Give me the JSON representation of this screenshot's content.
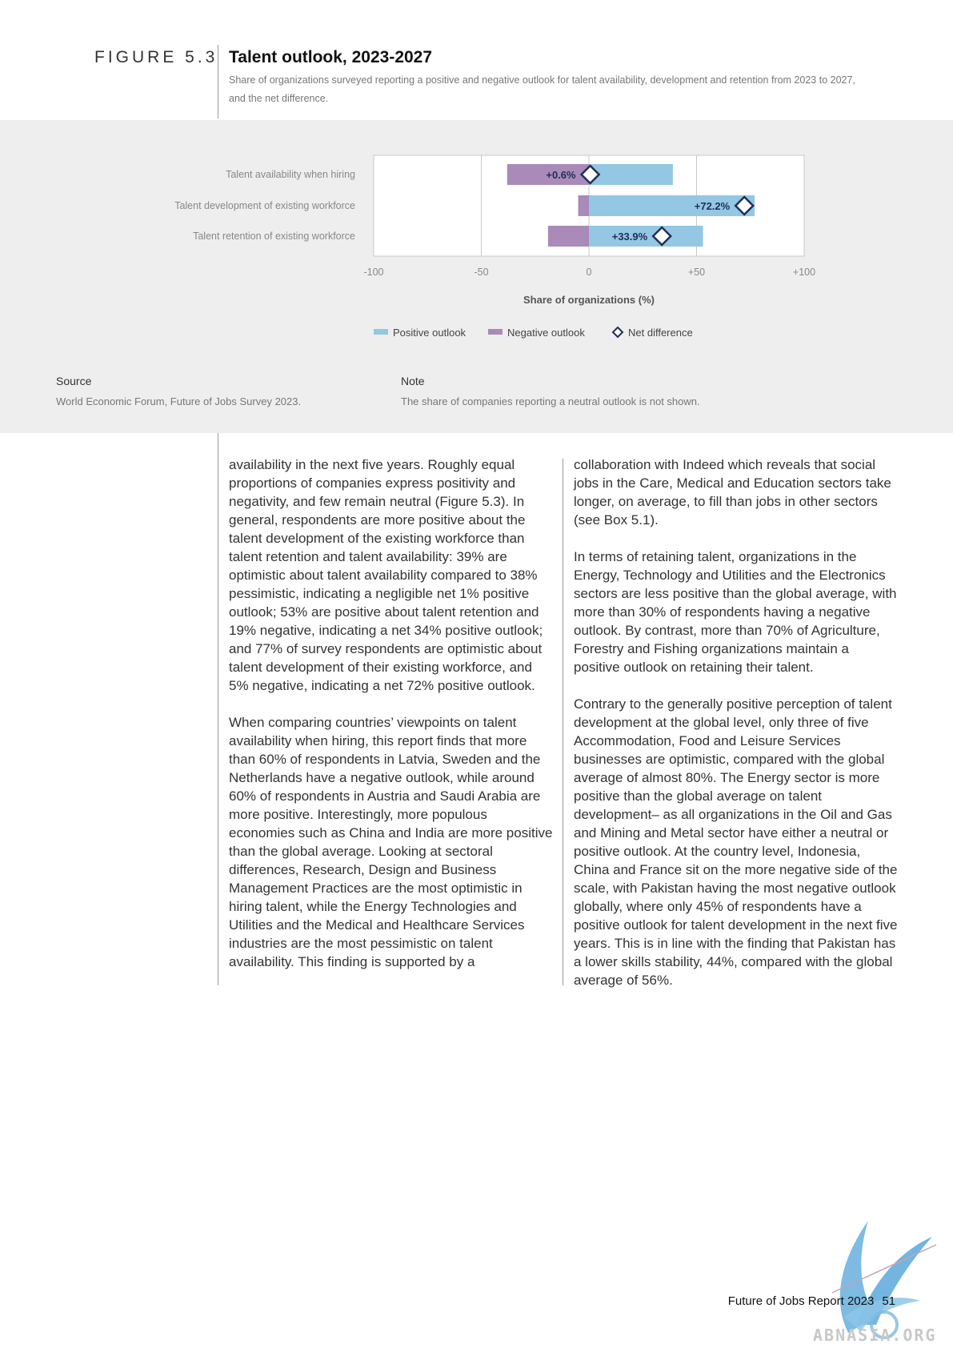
{
  "figure": {
    "label": "FIGURE 5.3",
    "title": "Talent outlook, 2023-2027",
    "subtitle": "Share of organizations surveyed reporting a positive and negative outlook for talent availability, development and retention from 2023 to 2027, and the net difference."
  },
  "chart_data": {
    "type": "bar",
    "orientation": "horizontal",
    "stacked": "diverging",
    "categories": [
      "Talent availability when hiring",
      "Talent development of existing workforce",
      "Talent retention of existing workforce"
    ],
    "series": [
      {
        "name": "Positive outlook",
        "color": "#93c7e3",
        "values": [
          39,
          77,
          53
        ]
      },
      {
        "name": "Negative outlook",
        "color": "#a98ab9",
        "values": [
          -38,
          -5,
          -19
        ]
      }
    ],
    "net_difference": {
      "name": "Net difference",
      "values": [
        0.6,
        72.2,
        33.9
      ],
      "labels": [
        "+0.6%",
        "+72.2%",
        "+33.9%"
      ],
      "marker": "diamond",
      "marker_color": "#1f2e5a"
    },
    "xlabel": "Share of organizations (%)",
    "xlim": [
      -100,
      100
    ],
    "xticks": [
      -100,
      -50,
      0,
      50,
      100
    ],
    "xtick_labels": [
      "-100",
      "-50",
      "0",
      "+50",
      "+100"
    ],
    "grid": "vertical",
    "legend": "bottom"
  },
  "source": {
    "label": "Source",
    "text": "World Economic Forum, Future of Jobs Survey 2023."
  },
  "note": {
    "label": "Note",
    "text": "The share of companies reporting a neutral outlook is not shown."
  },
  "body": {
    "left": [
      "availability in the next five years. Roughly equal proportions of companies express positivity and negativity, and few remain neutral (Figure 5.3). In general, respondents are more positive about the talent development of the existing workforce than talent retention and talent availability: 39% are optimistic about talent availability compared to 38% pessimistic, indicating a negligible net 1% positive outlook; 53% are positive about talent retention and 19% negative, indicating a net 34% positive outlook; and 77% of survey respondents are optimistic about talent development of their existing workforce, and 5% negative, indicating a net 72% positive outlook.",
      "When comparing countries’ viewpoints on talent availability when hiring, this report finds that more than 60% of respondents in Latvia, Sweden and the Netherlands have a negative outlook, while around 60% of respondents in Austria and Saudi Arabia are more positive. Interestingly, more populous economies such as China and India are more positive than the global average. Looking at sectoral differences, Research, Design and Business Management Practices are the most optimistic in hiring talent, while the Energy Technologies and Utilities and the Medical and Healthcare Services industries are the most pessimistic on talent availability. This finding is supported by a"
    ],
    "right": [
      "collaboration with Indeed which reveals that social jobs in the Care, Medical and Education sectors take longer, on average, to fill than jobs in other sectors (see Box 5.1).",
      "In terms of retaining talent, organizations in the Energy, Technology and Utilities and the Electronics sectors are less positive than the global average, with more than 30% of respondents having a negative outlook. By contrast, more than 70% of Agriculture, Forestry and Fishing organizations maintain a positive outlook on retaining their talent.",
      "Contrary to the generally positive perception of talent development at the global level, only three of five Accommodation, Food and Leisure Services businesses are optimistic, compared with the global average of almost 80%. The Energy sector is more positive than the global average on talent development– as all organizations in the Oil and Gas and Mining and Metal sector have either a neutral or positive outlook. At the country level, Indonesia, China and France sit on the more negative side of the scale, with Pakistan having the most negative outlook globally, where only 45% of respondents have a positive outlook for talent development in the next five years. This is in line with the finding that Pakistan has a lower skills stability, 44%, compared with the global average of 56%."
    ]
  },
  "footer": {
    "report": "Future of Jobs Report 2023",
    "page": "51"
  },
  "watermark": {
    "text": "ABNASIA.ORG"
  }
}
